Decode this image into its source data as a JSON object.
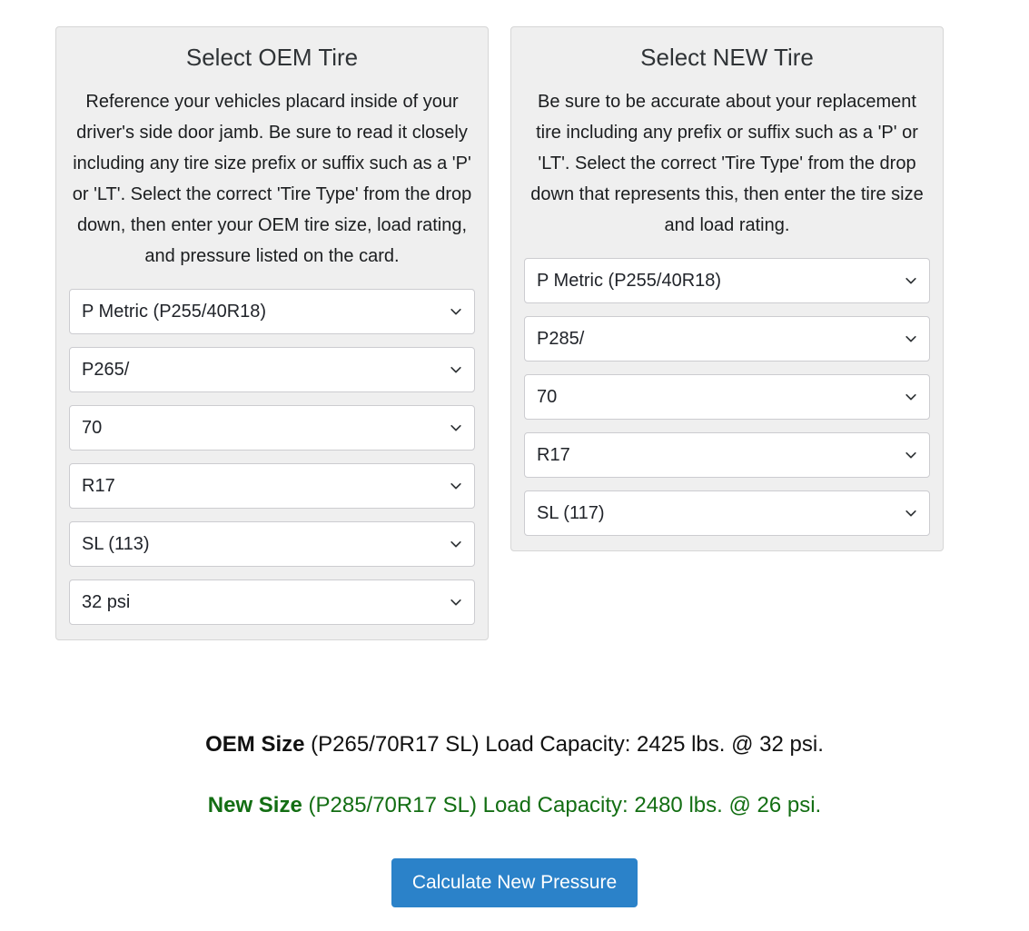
{
  "colors": {
    "panel_bg": "#efefef",
    "panel_border": "#d6d6d6",
    "button_blue": "#2b82c9",
    "new_size_green": "#136e13",
    "text": "#212529"
  },
  "panels": [
    {
      "title": "Select OEM Tire",
      "description": "Reference your vehicles placard inside of your driver's side door jamb. Be sure to read it closely including any tire size prefix or suffix such as a 'P' or 'LT'. Select the correct 'Tire Type' from the drop down, then enter your OEM tire size, load rating, and pressure listed on the card.",
      "selects": [
        {
          "name": "tire-type",
          "value": "P Metric (P255/40R18)",
          "icon": "chevron-down-icon"
        },
        {
          "name": "section-width",
          "value": "P265/",
          "icon": "chevron-down-icon"
        },
        {
          "name": "aspect-ratio",
          "value": "70",
          "icon": "chevron-down-icon"
        },
        {
          "name": "rim-diameter",
          "value": "R17",
          "icon": "chevron-down-icon"
        },
        {
          "name": "load-rating",
          "value": "SL (113)",
          "icon": "chevron-down-icon"
        },
        {
          "name": "pressure",
          "value": "32 psi",
          "icon": "chevron-down-icon"
        }
      ]
    },
    {
      "title": "Select NEW Tire",
      "description": "Be sure to be accurate about your replacement tire including any prefix or suffix such as a 'P' or 'LT'. Select the correct 'Tire Type' from the drop down that represents this, then enter the tire size and load rating.",
      "selects": [
        {
          "name": "tire-type",
          "value": "P Metric (P255/40R18)",
          "icon": "chevron-down-icon"
        },
        {
          "name": "section-width",
          "value": "P285/",
          "icon": "chevron-down-icon"
        },
        {
          "name": "aspect-ratio",
          "value": "70",
          "icon": "chevron-down-icon"
        },
        {
          "name": "rim-diameter",
          "value": "R17",
          "icon": "chevron-down-icon"
        },
        {
          "name": "load-rating",
          "value": "SL (117)",
          "icon": "chevron-down-icon"
        }
      ]
    }
  ],
  "results": {
    "oem": {
      "label": "OEM Size",
      "detail": " (P265/70R17 SL) Load Capacity: 2425 lbs. @ 32 psi."
    },
    "new": {
      "label": "New Size",
      "detail": " (P285/70R17 SL) Load Capacity: 2480 lbs. @ 26 psi."
    }
  },
  "button": {
    "label": "Calculate New Pressure"
  }
}
